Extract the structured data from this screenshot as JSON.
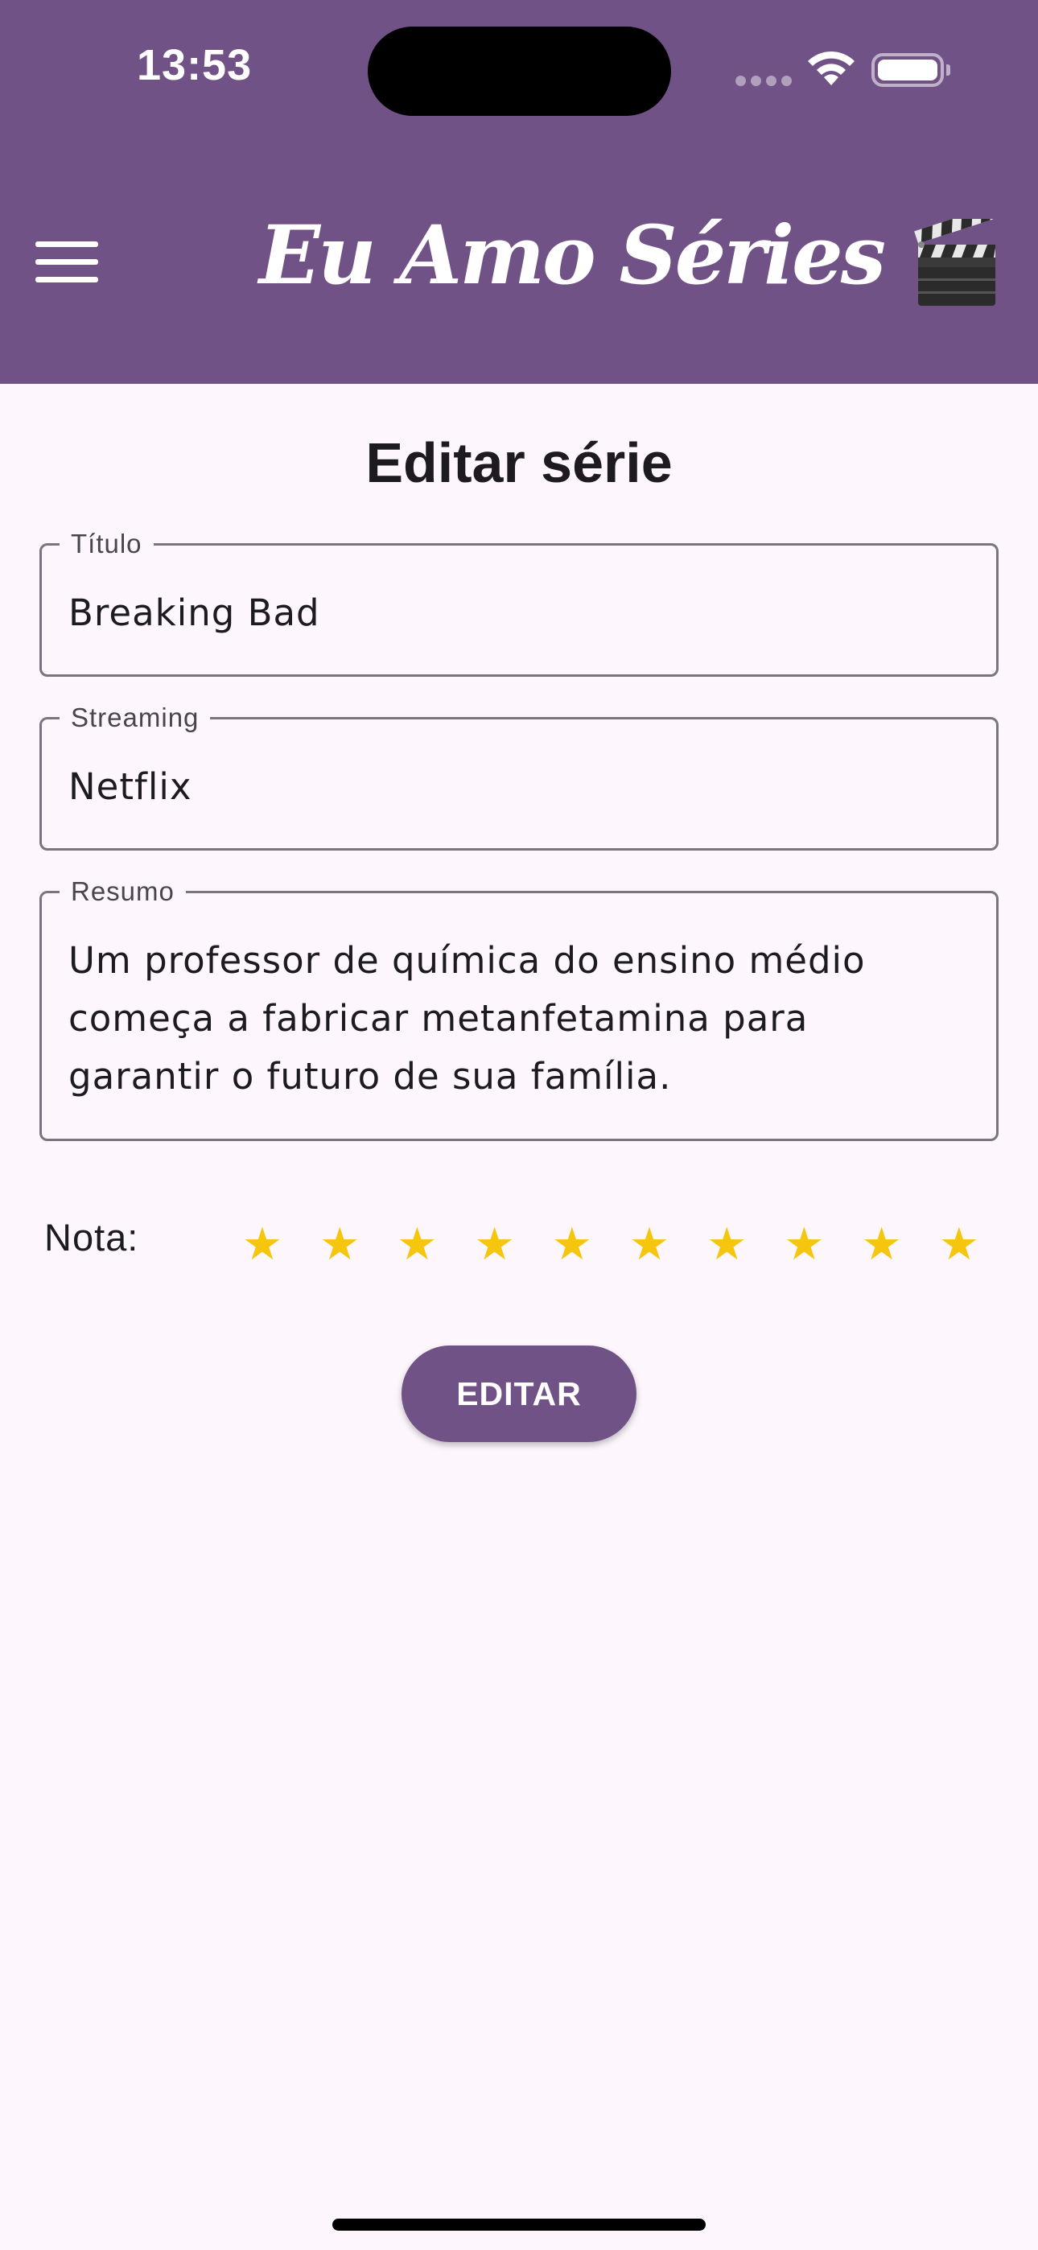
{
  "status_bar": {
    "time": "13:53"
  },
  "app_bar": {
    "title": "Eu Amo Séries",
    "title_icon": "clapper-board-icon",
    "menu_icon": "hamburger-menu-icon",
    "background_color": "#705286"
  },
  "page": {
    "title": "Editar série"
  },
  "form": {
    "titulo": {
      "label": "Título",
      "value": "Breaking Bad"
    },
    "streaming": {
      "label": "Streaming",
      "value": "Netflix"
    },
    "resumo": {
      "label": "Resumo",
      "value": "Um professor de química do ensino médio começa a fabricar metanfetamina para garantir o futuro de sua família."
    }
  },
  "rating": {
    "label": "Nota:",
    "max": 10,
    "value": 10,
    "star_color": "#F6C50E"
  },
  "actions": {
    "edit_label": "EDITAR"
  }
}
